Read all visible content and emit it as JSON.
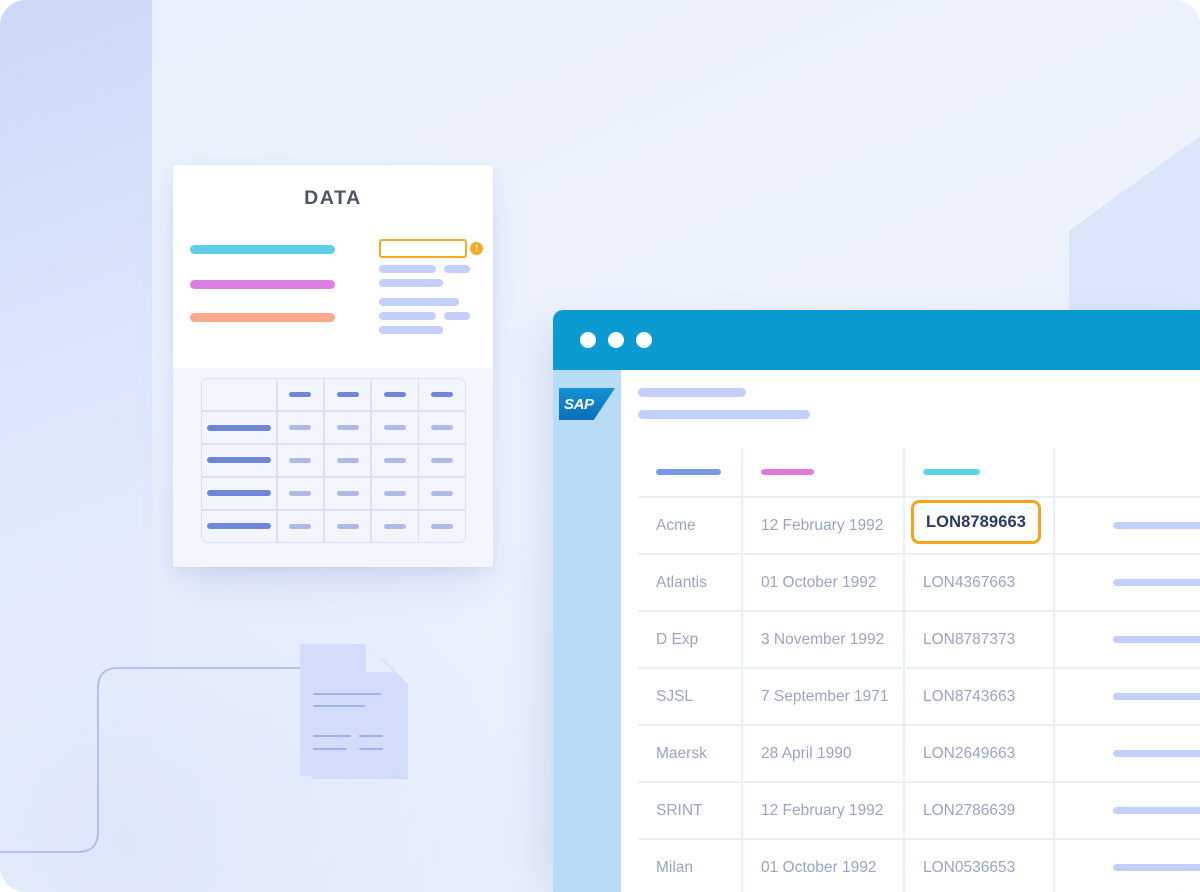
{
  "background": {
    "polygon_color": "#d6e0fa",
    "connector_color": "#aebaf0"
  },
  "data_card": {
    "title": "DATA",
    "bars": [
      {
        "name": "bar-cyan",
        "color": "#5ccfe6"
      },
      {
        "name": "bar-pink",
        "color": "#dd7ee1"
      },
      {
        "name": "bar-salmon",
        "color": "#fba88d"
      }
    ],
    "input_field": {
      "value": "",
      "border_color": "#f9a825"
    },
    "warning_badge": {
      "glyph": "!",
      "color": "#f9ab28"
    },
    "mini_grid": {
      "columns": 5,
      "rows": 5,
      "header_pill_color": "#6d86d8",
      "body_pill_color": "#aebbe8"
    }
  },
  "documents": {
    "icon": "documents-stack-icon",
    "color": "#ccd7fa"
  },
  "browser": {
    "titlebar_color": "#0a9ad2",
    "window_dots": [
      "close-dot",
      "minimize-dot",
      "maximize-dot"
    ],
    "sidebar": {
      "background": "#b9dcf6",
      "logo_text": "SAP"
    },
    "header_placeholders": [
      "",
      ""
    ],
    "table": {
      "header_bar_colors": [
        "#7b95ee",
        "#e078d8",
        "#5fd3ec",
        "#71d18c"
      ],
      "columns": [
        "",
        "",
        "",
        ""
      ],
      "rows": [
        {
          "company": "Acme",
          "date": "12 February 1992",
          "reference": "LON8789663",
          "extra": "",
          "highlighted": true
        },
        {
          "company": "Atlantis",
          "date": "01 October 1992",
          "reference": "LON4367663",
          "extra": "",
          "highlighted": false
        },
        {
          "company": "D Exp",
          "date": "3 November 1992",
          "reference": "LON8787373",
          "extra": "",
          "highlighted": false
        },
        {
          "company": "SJSL",
          "date": "7 September 1971",
          "reference": "LON8743663",
          "extra": "",
          "highlighted": false
        },
        {
          "company": "Maersk",
          "date": "28 April 1990",
          "reference": "LON2649663",
          "extra": "",
          "highlighted": false
        },
        {
          "company": "SRINT",
          "date": "12 February 1992",
          "reference": "LON2786639",
          "extra": "",
          "highlighted": false
        },
        {
          "company": "Milan",
          "date": "01 October 1992",
          "reference": "LON0536653",
          "extra": "",
          "highlighted": false
        }
      ],
      "highlight_color": "#f9a31a",
      "highlight_text_color": "#2b3a66"
    }
  }
}
